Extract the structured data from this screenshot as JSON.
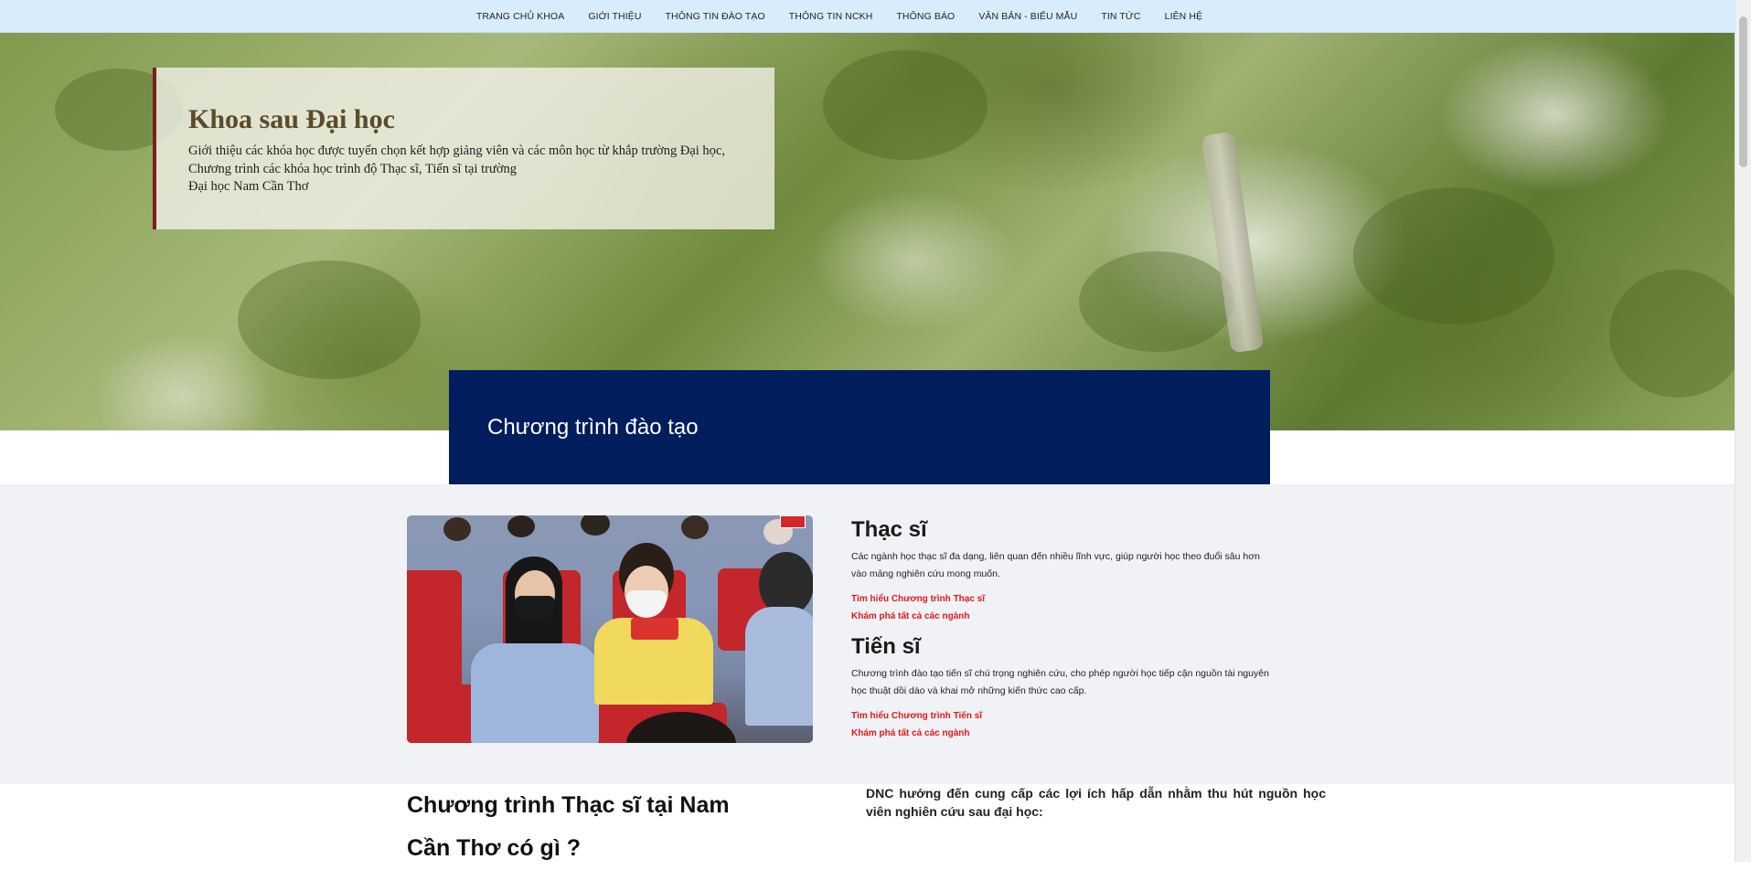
{
  "nav": {
    "items": [
      "TRANG CHỦ KHOA",
      "GIỚI THIỆU",
      "THÔNG TIN ĐÀO TẠO",
      "THÔNG TIN NCKH",
      "THÔNG BÁO",
      "VĂN BẢN - BIỂU MẪU",
      "TIN TỨC",
      "LIÊN HỆ"
    ]
  },
  "hero": {
    "title": "Khoa sau Đại học",
    "lines": [
      "Giới thiệu các khóa học được tuyển chọn kết hợp giảng viên và các môn học từ khắp trường Đại học,",
      "Chương trình các khóa học trình độ Thạc sĩ, Tiến sĩ tại trường",
      "Đại học Nam Cần Thơ"
    ]
  },
  "banner": {
    "title": "Chương trình đào tạo"
  },
  "programs": [
    {
      "title": "Thạc sĩ",
      "description": "Các ngành học thạc sĩ đa dạng, liên quan đến nhiều lĩnh vực, giúp người học theo đuổi sâu hơn vào mảng nghiên cứu mong muốn.",
      "link1": "Tìm hiểu Chương trình Thạc sĩ",
      "link2": "Khám phá tất cả các ngành"
    },
    {
      "title": "Tiến sĩ",
      "description": "Chương trình đào tạo tiến sĩ chú trọng nghiên cứu, cho phép người học tiếp cận nguồn tài nguyên học thuật dồi dào và khai mở những kiến thức cao cấp.",
      "link1": "Tìm hiểu Chương trình Tiến sĩ",
      "link2": "Khám phá tất cả các ngành"
    }
  ],
  "bottom": {
    "heading": "Chương trình Thạc sĩ tại Nam Cần Thơ có gì ?",
    "paragraph": "DNC hướng đến cung cấp các lợi ích hấp dẫn nhằm thu hút nguồn học viên nghiên cứu sau đại học:"
  },
  "colors": {
    "nav_bg": "#d8ecfb",
    "banner_bg": "#001d5e",
    "accent_border": "#7a1f1f",
    "link_red": "#e01818",
    "section_gray": "#f1f2f6"
  }
}
